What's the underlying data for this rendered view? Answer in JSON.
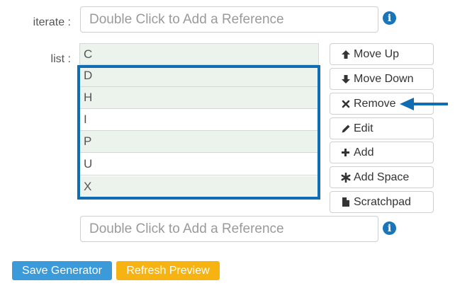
{
  "form": {
    "iterate_label": "iterate :",
    "iterate_placeholder": "Double Click to Add a Reference",
    "list_label": "list :",
    "new_reference_placeholder": "Double Click to Add a Reference"
  },
  "list": {
    "items": [
      "C",
      "D",
      "H",
      "I",
      "P",
      "U",
      "X"
    ],
    "highlighted_items": [
      "D",
      "H",
      "I",
      "P",
      "U",
      "X"
    ]
  },
  "actions": {
    "move_up": "Move Up",
    "move_down": "Move Down",
    "remove": "Remove",
    "edit": "Edit",
    "add": "Add",
    "add_space": "Add Space",
    "scratchpad": "Scratchpad"
  },
  "footer": {
    "save_label": "Save Generator",
    "refresh_label": "Refresh Preview"
  },
  "icons": {
    "info": "info-icon",
    "move_up": "arrow-up-icon",
    "move_down": "arrow-down-icon",
    "remove": "times-icon",
    "edit": "pencil-icon",
    "add": "plus-icon",
    "add_space": "asterisk-icon",
    "scratchpad": "file-icon",
    "annotation": "arrow-left-icon"
  },
  "colors": {
    "accent_blue": "#0f6db3",
    "save_button": "#3b9ad9",
    "refresh_button": "#f6b311",
    "row_shade": "#ecf2ec",
    "info_icon": "#1a74b8"
  }
}
